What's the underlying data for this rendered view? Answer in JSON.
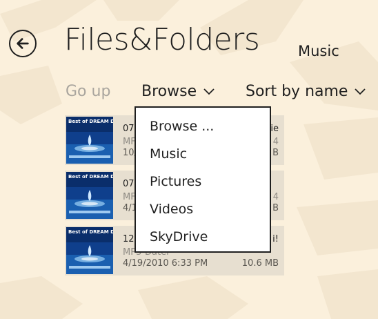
{
  "header": {
    "title": "Files&Folders",
    "subtitle": "Music"
  },
  "icons": {
    "back": "back-arrow-icon",
    "chevron": "chevron-down-icon"
  },
  "commands": {
    "go_up": "Go up",
    "browse": "Browse",
    "sort": "Sort by name"
  },
  "files": [
    {
      "name": "07",
      "type": "MF",
      "date": "10/",
      "right_top": "ie",
      "right_mid": "4",
      "size": "B",
      "album_label": "Best of DREAM DANCE"
    },
    {
      "name": "07",
      "type": "MF",
      "date": "4/1",
      "right_top": "",
      "right_mid": "4",
      "size": "B",
      "album_label": "Best of DREAM DANCE"
    },
    {
      "name": "12",
      "type": "MP3-Datei",
      "date": "4/19/2010 6:33 PM",
      "right_top": "i!",
      "right_mid": "",
      "size": "10.6 MB",
      "album_label": "Best of DREAM DANCE"
    }
  ],
  "browse_menu": {
    "items": [
      "Browse ...",
      "Music",
      "Pictures",
      "Videos",
      "SkyDrive"
    ]
  },
  "colors": {
    "background": "#fbf0dc",
    "tile": "#e7dfd0",
    "disabled_text": "#a9a59e",
    "text": "#1f1f1f"
  }
}
